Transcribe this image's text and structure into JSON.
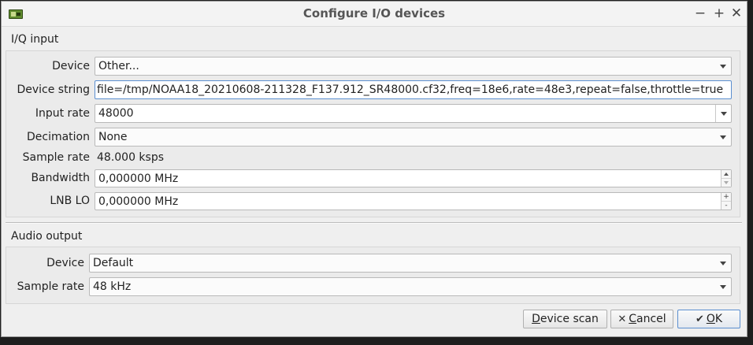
{
  "window": {
    "title": "Configure I/O devices"
  },
  "iq": {
    "section_label": "I/Q input",
    "device_label": "Device",
    "device_value": "Other...",
    "device_string_label": "Device string",
    "device_string_value": "file=/tmp/NOAA18_20210608-211328_F137.912_SR48000.cf32,freq=18e6,rate=48e3,repeat=false,throttle=true",
    "input_rate_label": "Input rate",
    "input_rate_value": "48000",
    "decimation_label": "Decimation",
    "decimation_value": "None",
    "sample_rate_label": "Sample rate",
    "sample_rate_value": "48.000 ksps",
    "bandwidth_label": "Bandwidth",
    "bandwidth_value": "0,000000 MHz",
    "lnb_lo_label": "LNB LO",
    "lnb_lo_value": "0,000000 MHz"
  },
  "audio": {
    "section_label": "Audio output",
    "device_label": "Device",
    "device_value": "Default",
    "sample_rate_label": "Sample rate",
    "sample_rate_value": "48 kHz"
  },
  "buttons": {
    "device_scan_mnemonic": "D",
    "device_scan_rest": "evice scan",
    "cancel_mnemonic": "C",
    "cancel_rest": "ancel",
    "ok_mnemonic": "O",
    "ok_rest": "K"
  },
  "icons": {
    "app": "gqrx-app-icon",
    "minimize": "minimize-icon",
    "maximize": "maximize-icon",
    "close": "close-icon",
    "cancel": "x-icon",
    "ok": "checkmark-icon"
  }
}
